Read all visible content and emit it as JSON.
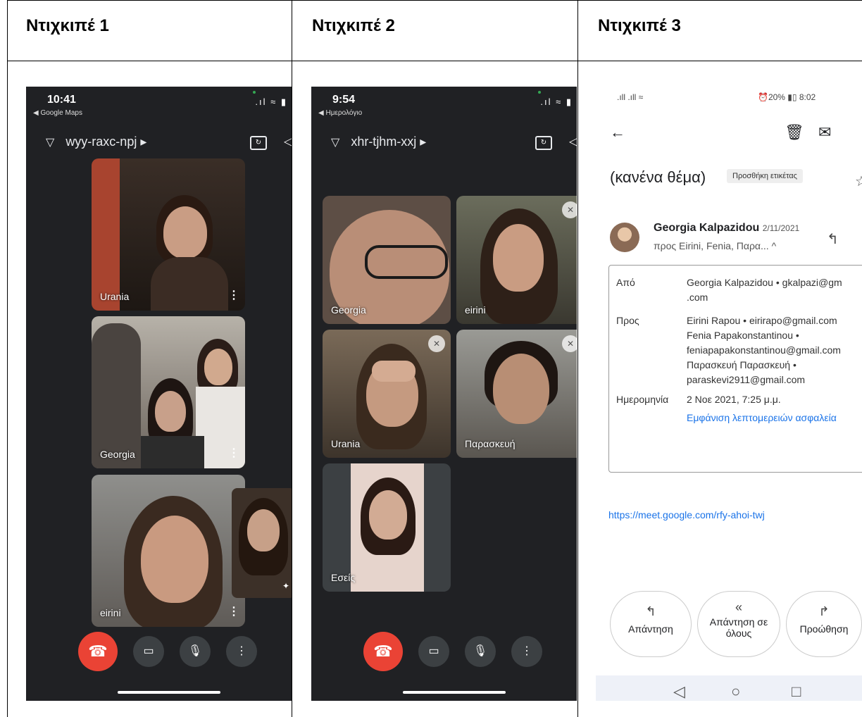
{
  "table": {
    "headers": [
      "Ντιχκιπέ 1",
      "Ντιχκιπέ  2",
      "Ντιχκιπέ 3"
    ]
  },
  "panel1": {
    "time": "10:41",
    "back_app": "◀ Google Maps",
    "meeting_code": "wyy-raxc-npj ▸",
    "participants": [
      "Urania",
      "Georgia",
      "eirini"
    ]
  },
  "panel2": {
    "time": "9:54",
    "back_app": "◀ Ημερολόγιο",
    "meeting_code": "xhr-tjhm-xxj ▸",
    "participants": [
      "Georgia",
      "eirini",
      "Urania",
      "Παρασκευή",
      "Εσείς"
    ]
  },
  "panel3": {
    "status_left": ".ıll .ıll ≈",
    "status_right": "⏰20% ▮▯ 8:02",
    "subject": "(κανένα θέμα)",
    "label_chip": "Προσθήκη ετικέτας",
    "sender_name": "Georgia Kalpazidou",
    "sender_date": "2/11/2021",
    "recipients_summary": "προς Eirini, Fenia, Παρα...  ^",
    "details": {
      "from_label": "Από",
      "from_value_1": "Georgia Kalpazidou • gkalpazi@gm",
      "from_value_2": ".com",
      "to_label": "Προς",
      "to_lines": [
        "Eirini Rapou • eirirapo@gmail.com",
        "Fenia Papakonstantinou •",
        "feniapapakonstantinou@gmail.com",
        "Παρασκευή Παρασκευή •",
        "paraskevi2911@gmail.com"
      ],
      "date_label": "Ημερομηνία",
      "date_value": "2 Νοε 2021, 7:25 μ.μ.",
      "security_link": "Εμφάνιση λεπτομερειών ασφαλεία"
    },
    "meet_link": "https://meet.google.com/rfy-ahoi-twj",
    "actions": {
      "reply": "Απάντηση",
      "reply_all_1": "Απάντηση σε",
      "reply_all_2": "όλους",
      "forward": "Προώθηση"
    }
  }
}
